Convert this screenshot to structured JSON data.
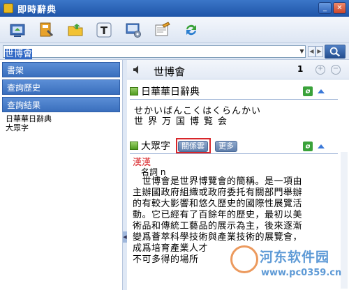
{
  "window": {
    "title": "即時辭典"
  },
  "search": {
    "value": "世博會"
  },
  "sidebar": {
    "tabs": [
      {
        "label": "書架"
      },
      {
        "label": "查詢歷史"
      },
      {
        "label": "查詢結果"
      }
    ],
    "results": [
      "日華華日辭典",
      "大眾字"
    ]
  },
  "word": {
    "headword": "世博會",
    "count": "1"
  },
  "sections": [
    {
      "title": "日華華日辭典",
      "reading": "せかいばんこくはくらんかい",
      "kanji": "世界万国博覧会"
    },
    {
      "title": "大眾字",
      "chip_related": "關係雲",
      "chip_more": "更多",
      "entry": "漢漢",
      "pos": "名詞 n",
      "lines": [
        "　世博會是世界博覽會的簡稱。是一項由",
        "主辦國政府組織或政府委托有關部門舉辦",
        "的有較大影響和悠久歷史的國際性展覽活",
        "動。它已經有了百餘年的歷史，最初以美",
        "術品和傳統工藝品的展示為主，後來逐漸",
        "變爲薈萃科學技術與產業技術的展覽會，",
        "成爲培育產業人才",
        "不可多得的場所"
      ]
    }
  ],
  "watermark": {
    "title": "河东软件园",
    "url": "www.pc0359.cn"
  },
  "colors": {
    "accent": "#3a6fbd",
    "entry_red": "#d8262a",
    "section_green": "#4e9a1e"
  }
}
